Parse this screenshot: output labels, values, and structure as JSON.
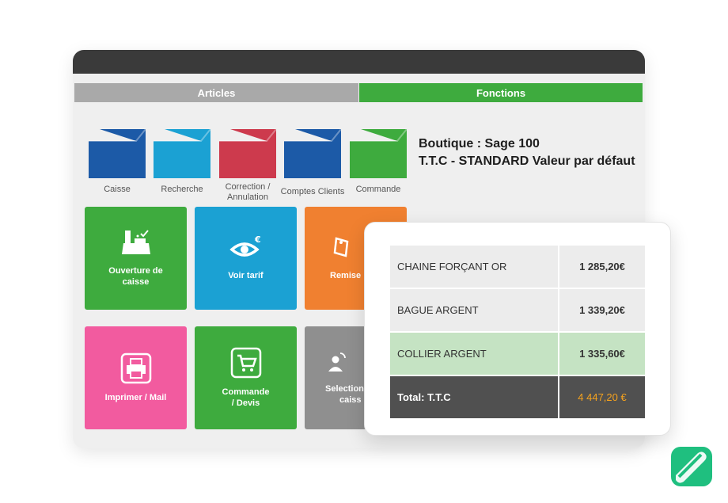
{
  "tabs": {
    "articles": "Articles",
    "fonctions": "Fonctions"
  },
  "folders": [
    {
      "label": "Caisse",
      "color": "#1c5aa7"
    },
    {
      "label": "Recherche",
      "color": "#1ba1d3"
    },
    {
      "label": "Correction / Annulation",
      "color": "#cd3a4d"
    },
    {
      "label": "Comptes Clients",
      "color": "#1c5aa7"
    },
    {
      "label": "Commande",
      "color": "#3eab3e"
    }
  ],
  "boutique": {
    "line1": "Boutique : Sage 100",
    "line2": "T.T.C - STANDARD Valeur par défaut"
  },
  "tiles": {
    "ouverture": {
      "label_1": "Ouverture de",
      "label_2": "caisse",
      "color": "#3eab3e",
      "icon": "cash-register-icon"
    },
    "voir_tarif": {
      "label": "Voir tarif",
      "color": "#1ba1d3",
      "icon": "eye-euro-icon"
    },
    "remise": {
      "label": "Remise",
      "color": "#f08030",
      "icon": "price-tag-icon"
    },
    "imprimer": {
      "label": "Imprimer / Mail",
      "color": "#f25b9f",
      "icon": "printer-icon"
    },
    "commande": {
      "label_1": "Commande",
      "label_2": "/ Devis",
      "color": "#3eab3e",
      "icon": "shopping-cart-icon"
    },
    "selection": {
      "label_1": "Selection",
      "label_2": "caiss",
      "color": "#8f8f8f",
      "icon": "user-switch-icon"
    }
  },
  "ticket": {
    "rows": [
      {
        "item": "CHAINE FORÇANT OR",
        "amount": "1 285,20€"
      },
      {
        "item": "BAGUE ARGENT",
        "amount": "1 339,20€"
      },
      {
        "item": "COLLIER ARGENT",
        "amount": "1 335,60€"
      }
    ],
    "total_label": "Total: T.T.C",
    "total_amount": "4 447,20 €",
    "total_color": "#f4a21e",
    "highlight_color": "#c5e3c3"
  },
  "logo": {
    "icon": "brand-logo-icon",
    "color": "#1fbf7f"
  }
}
